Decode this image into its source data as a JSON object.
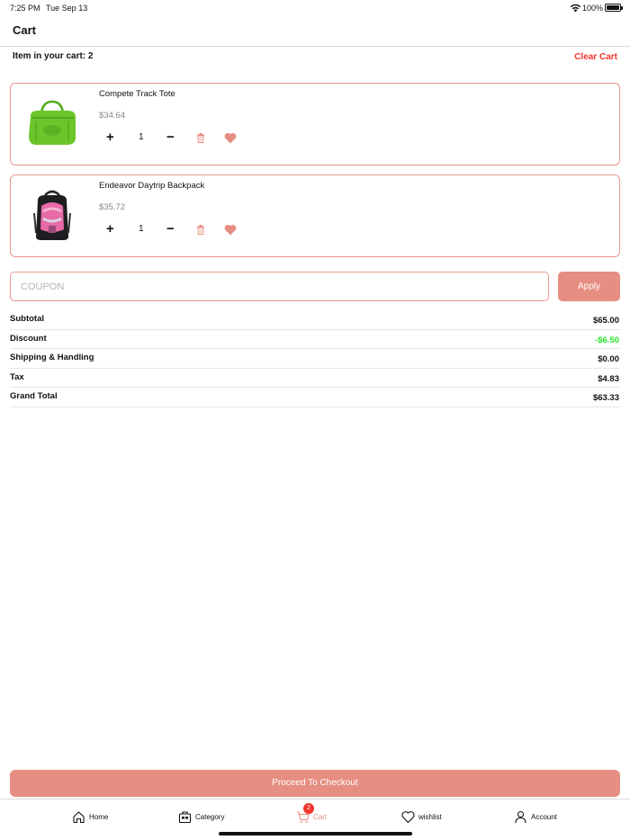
{
  "status_bar": {
    "time": "7:25 PM",
    "date": "Tue Sep 13",
    "battery": "100%"
  },
  "header": {
    "title": "Cart"
  },
  "cart": {
    "count_label": "Item in your cart: 2",
    "clear_label": "Clear Cart",
    "items": [
      {
        "name": "Compete Track Tote",
        "price": "$34.64",
        "quantity": "1",
        "image": "green-tote-bag"
      },
      {
        "name": "Endeavor Daytrip Backpack",
        "price": "$35.72",
        "quantity": "1",
        "image": "pink-black-backpack"
      }
    ]
  },
  "coupon": {
    "placeholder": "COUPON",
    "apply_label": "Apply"
  },
  "summary": [
    {
      "label": "Subtotal",
      "value": "$65.00"
    },
    {
      "label": "Discount",
      "value": "-$6.50"
    },
    {
      "label": "Shipping & Handling",
      "value": "$0.00"
    },
    {
      "label": "Tax",
      "value": "$4.83"
    },
    {
      "label": "Grand Total",
      "value": "$63.33"
    }
  ],
  "checkout_label": "Proceed To Checkout",
  "tabbar": {
    "items": [
      {
        "label": "Home",
        "icon": "home-icon"
      },
      {
        "label": "Category",
        "icon": "category-icon"
      },
      {
        "label": "Cart",
        "icon": "cart-icon",
        "badge": "2"
      },
      {
        "label": "wishlist",
        "icon": "heart-icon"
      },
      {
        "label": "Account",
        "icon": "person-icon"
      }
    ]
  },
  "colors": {
    "accent": "#e58e81",
    "danger": "#f0352a",
    "discount": "#2ee52e"
  }
}
